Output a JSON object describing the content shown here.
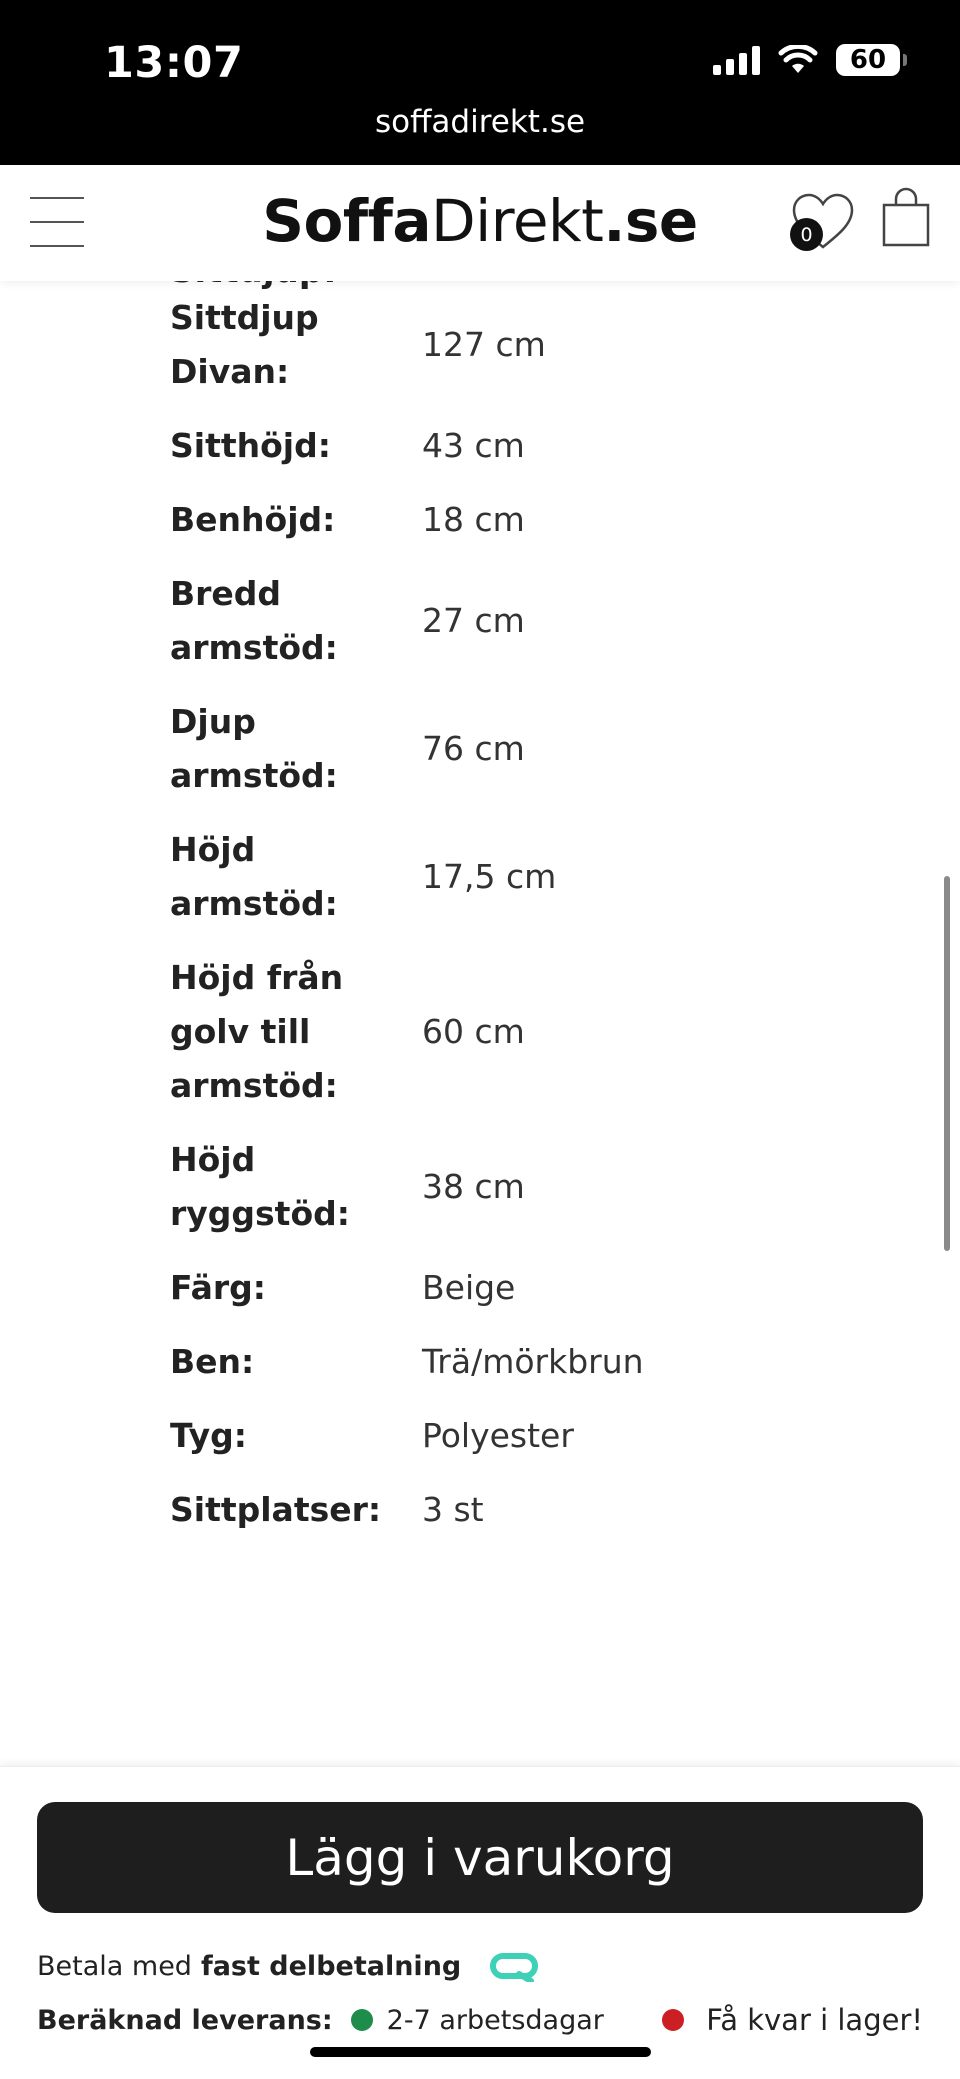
{
  "status_bar": {
    "time": "13:07",
    "battery": "60"
  },
  "browser": {
    "url": "soffadirekt.se"
  },
  "header": {
    "logo_bold1": "Soffa",
    "logo_light": "Direkt",
    "logo_bold2": ".se",
    "wishlist_count": "0"
  },
  "specs": {
    "cut_label": "Sittdjup:",
    "rows": [
      {
        "label": "Sittdjup Divan:",
        "value": "127 cm"
      },
      {
        "label": "Sitthöjd:",
        "value": "43 cm"
      },
      {
        "label": "Benhöjd:",
        "value": "18 cm"
      },
      {
        "label": "Bredd armstöd:",
        "value": "27 cm"
      },
      {
        "label": "Djup armstöd:",
        "value": "76 cm"
      },
      {
        "label": "Höjd armstöd:",
        "value": "17,5 cm"
      },
      {
        "label": "Höjd från golv till armstöd:",
        "value": "60 cm"
      },
      {
        "label": "Höjd ryggstöd:",
        "value": "38 cm"
      },
      {
        "label": "Färg:",
        "value": "Beige"
      },
      {
        "label": "Ben:",
        "value": "Trä/mörkbrun"
      },
      {
        "label": "Tyg:",
        "value": "Polyester"
      },
      {
        "label": "Sittplatser:",
        "value": "3 st"
      }
    ]
  },
  "purchase": {
    "add_to_cart": "Lägg i varukorg",
    "payment_prefix": "Betala med",
    "payment_bold": "fast delbetalning",
    "delivery_label": "Beräknad leverans:",
    "delivery_time": "2-7 arbetsdagar",
    "stock_status": "Få kvar i lager!",
    "colors": {
      "in_delivery": "#1e8c4a",
      "low_stock": "#cc1f24",
      "qliro_accent": "#3fd1b8"
    }
  }
}
